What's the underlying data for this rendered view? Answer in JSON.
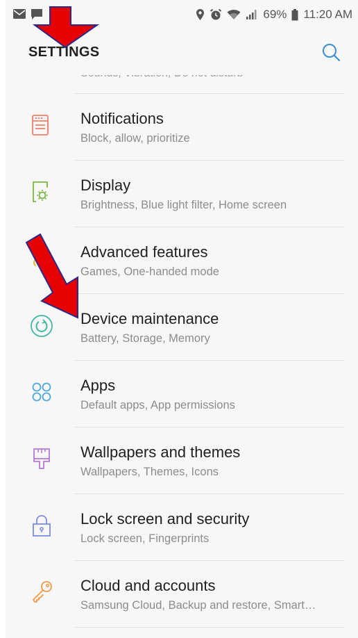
{
  "status_bar": {
    "battery": "69%",
    "time": "11:20 AM",
    "icons": [
      "mail-icon",
      "chat-icon",
      "location-icon",
      "alarm-icon",
      "wifi-icon",
      "signal-icon",
      "battery-icon"
    ]
  },
  "header": {
    "title": "SETTINGS",
    "search_icon": "search-icon"
  },
  "partial_item": {
    "subtitle": "Sounds, Vibration, Do not disturb"
  },
  "items": [
    {
      "label": "Notifications",
      "subtitle": "Block, allow, prioritize",
      "icon": "notifications-icon",
      "color": "#ef7f6a"
    },
    {
      "label": "Display",
      "subtitle": "Brightness, Blue light filter, Home screen",
      "icon": "display-icon",
      "color": "#79b840"
    },
    {
      "label": "Advanced features",
      "subtitle": "Games, One-handed mode",
      "icon": "advanced-features-icon",
      "color": "#f0b22a"
    },
    {
      "label": "Device maintenance",
      "subtitle": "Battery, Storage, Memory",
      "icon": "device-maintenance-icon",
      "color": "#3bb8a0"
    },
    {
      "label": "Apps",
      "subtitle": "Default apps, App permissions",
      "icon": "apps-icon",
      "color": "#4aa8e0"
    },
    {
      "label": "Wallpapers and themes",
      "subtitle": "Wallpapers, Themes, Icons",
      "icon": "wallpapers-themes-icon",
      "color": "#b77ad6"
    },
    {
      "label": "Lock screen and security",
      "subtitle": "Lock screen, Fingerprints",
      "icon": "lock-icon",
      "color": "#7b8ee0"
    },
    {
      "label": "Cloud and accounts",
      "subtitle": "Samsung Cloud, Backup and restore, Smart…",
      "icon": "key-icon",
      "color": "#f09a45"
    }
  ],
  "annotation_color": "#e60000"
}
